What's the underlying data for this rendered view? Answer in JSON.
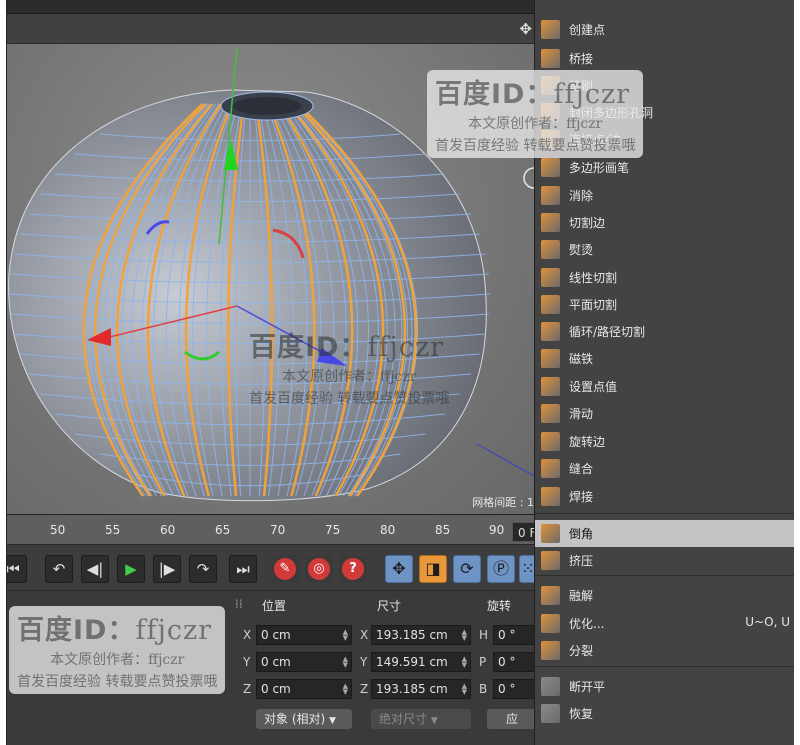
{
  "viewport": {
    "grid_label": "网格间距 : 1"
  },
  "timeline": {
    "ticks": [
      "50",
      "55",
      "60",
      "65",
      "70",
      "75",
      "80",
      "85",
      "90"
    ],
    "current_frame": "0 F"
  },
  "coords": {
    "position_header": "位置",
    "size_header": "尺寸",
    "rotation_header": "旋转",
    "rows": [
      {
        "axis": "X",
        "position": "0 cm",
        "size_axis": "X",
        "size": "193.185 cm",
        "rot_axis": "H",
        "rotation": "0 °"
      },
      {
        "axis": "Y",
        "position": "0 cm",
        "size_axis": "Y",
        "size": "149.591 cm",
        "rot_axis": "P",
        "rotation": "0 °"
      },
      {
        "axis": "Z",
        "position": "0 cm",
        "size_axis": "Z",
        "size": "193.185 cm",
        "rot_axis": "B",
        "rotation": "0 °"
      }
    ],
    "mode_dropdown": "对象 (相对)",
    "size_dropdown": "绝对尺寸",
    "apply_label": "应"
  },
  "menu": {
    "items": [
      {
        "label": "创建点",
        "icon": "create-point-icon",
        "color": "#e0913a"
      },
      {
        "label": "桥接",
        "icon": "bridge-icon",
        "color": "#e0913a"
      },
      {
        "label": "笔刷",
        "icon": "brush-icon",
        "color": "#e0913a"
      },
      {
        "label": "封闭多边形孔洞",
        "icon": "close-hole-icon",
        "color": "#e0913a"
      },
      {
        "label": "连接点/边",
        "icon": "connect-icon",
        "color": "#e0913a"
      },
      {
        "label": "多边形画笔",
        "icon": "polygon-pen-icon",
        "color": "#e0913a"
      },
      {
        "label": "消除",
        "icon": "dissolve-icon",
        "color": "#e0913a"
      },
      {
        "label": "切割边",
        "icon": "edge-cut-icon",
        "color": "#e0913a"
      },
      {
        "label": "熨烫",
        "icon": "iron-icon",
        "color": "#e0913a"
      },
      {
        "label": "线性切割",
        "icon": "line-cut-icon",
        "color": "#e0913a"
      },
      {
        "label": "平面切割",
        "icon": "plane-cut-icon",
        "color": "#e0913a"
      },
      {
        "label": "循环/路径切割",
        "icon": "loop-cut-icon",
        "color": "#e0913a"
      },
      {
        "label": "磁铁",
        "icon": "magnet-icon",
        "color": "#e0913a"
      },
      {
        "label": "设置点值",
        "icon": "set-point-icon",
        "color": "#e0913a"
      },
      {
        "label": "滑动",
        "icon": "slide-icon",
        "color": "#e0913a"
      },
      {
        "label": "旋转边",
        "icon": "spin-edge-icon",
        "color": "#e0913a"
      },
      {
        "label": "缝合",
        "icon": "stitch-icon",
        "color": "#e0913a"
      },
      {
        "label": "焊接",
        "icon": "weld-icon",
        "color": "#e0913a"
      },
      {
        "label": "倒角",
        "icon": "bevel-icon",
        "color": "#e0913a"
      },
      {
        "label": "挤压",
        "icon": "extrude-icon",
        "color": "#e0913a"
      },
      {
        "label": "融解",
        "icon": "melt-icon",
        "color": "#e0913a"
      },
      {
        "label": "优化...",
        "icon": "optimize-icon",
        "color": "#e0913a",
        "shortcut": "U~O, U"
      },
      {
        "label": "分裂",
        "icon": "split-icon",
        "color": "#e0913a"
      },
      {
        "label": "断开平",
        "icon": "disconnect-icon",
        "color": "#8a8a8a"
      },
      {
        "label": "恢复",
        "icon": "restore-icon",
        "color": "#8a8a8a"
      }
    ]
  },
  "watermarks": [
    {
      "id_prefix": "百度ID：",
      "id_name": "ffjczr",
      "line2": "本文原创作者：ffjczr",
      "line3": "首发百度经验 转载要点赞投票哦"
    },
    {
      "id_prefix": "百度ID：",
      "id_name": "ffjczr",
      "line2": "本文原创作者：ffjczr",
      "line3": "首发百度经验 转载要点赞投票哦"
    },
    {
      "id_prefix": "百度ID：",
      "id_name": "ffjczr",
      "line2": "本文原创作者：ffjczr",
      "line3": "首发百度经验 转载要点赞投票哦"
    }
  ]
}
